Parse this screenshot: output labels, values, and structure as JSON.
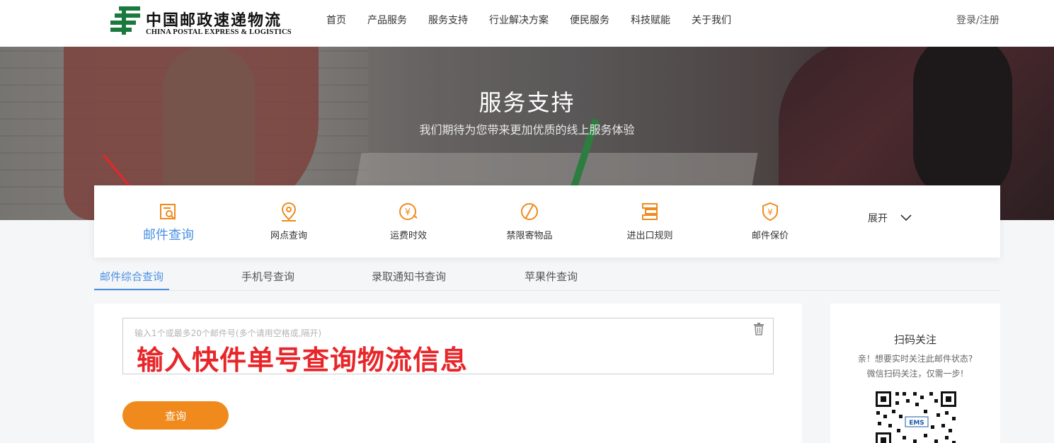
{
  "header": {
    "logo_cn": "中国邮政速递物流",
    "logo_en": "CHINA POSTAL EXPRESS & LOGISTICS",
    "nav": [
      "首页",
      "产品服务",
      "服务支持",
      "行业解决方案",
      "便民服务",
      "科技赋能",
      "关于我们"
    ],
    "login": "登录/注册"
  },
  "banner": {
    "title": "服务支持",
    "subtitle": "我们期待为您带来更加优质的线上服务体验"
  },
  "services": {
    "items": [
      {
        "label": "邮件查询",
        "icon": "mail-search-icon",
        "active": true
      },
      {
        "label": "网点查询",
        "icon": "location-pin-icon"
      },
      {
        "label": "运费时效",
        "icon": "yuan-clock-icon"
      },
      {
        "label": "禁限寄物品",
        "icon": "prohibited-icon"
      },
      {
        "label": "进出口规则",
        "icon": "customs-rules-icon"
      },
      {
        "label": "邮件保价",
        "icon": "yuan-shield-icon"
      }
    ],
    "expand_label": "展开"
  },
  "tabs": [
    "邮件综合查询",
    "手机号查询",
    "录取通知书查询",
    "苹果件查询"
  ],
  "query": {
    "placeholder": "输入1个或最多20个邮件号(多个请用空格或,隔开)",
    "annotation": "输入快件单号查询物流信息",
    "button_label": "查询"
  },
  "qr": {
    "title": "扫码关注",
    "line1": "亲！想要实时关注此邮件状态?",
    "line2": "微信扫码关注，仅需一步!",
    "badge": "EMS"
  },
  "colors": {
    "accent_blue": "#4a90e2",
    "orange": "#f08a1c",
    "brand_green": "#1a7a3e",
    "annotation_red": "#e8262a"
  }
}
